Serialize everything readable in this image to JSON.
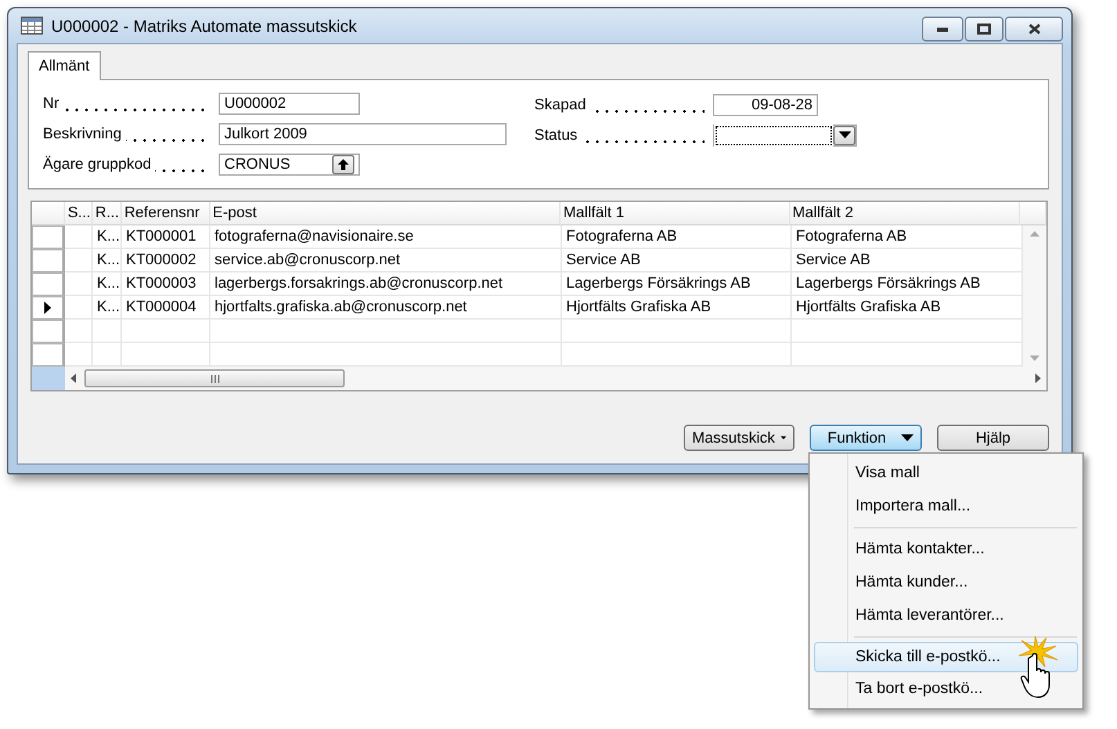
{
  "window": {
    "title": "U000002 - Matriks Automate massutskick"
  },
  "tabs": [
    {
      "label": "Allmänt",
      "selected": true
    }
  ],
  "fields_left": [
    {
      "label": "Nr",
      "value": "U000002",
      "kind": "text"
    },
    {
      "label": "Beskrivning",
      "value": "Julkort 2009",
      "kind": "wide"
    },
    {
      "label": "Ägare gruppkod",
      "value": "CRONUS",
      "kind": "lookup"
    }
  ],
  "fields_right": [
    {
      "label": "Skapad",
      "value": "09-08-28",
      "kind": "date"
    },
    {
      "label": "Status",
      "kind": "dropdown",
      "focused": true
    }
  ],
  "table": {
    "columns": [
      "S...",
      "R...",
      "Referensnr",
      "E-post",
      "Mallfält 1",
      "Mallfält 2"
    ],
    "rows": [
      {
        "cells": [
          "",
          "K...",
          "KT000001",
          "fotograferna@navisionaire.se",
          "Fotograferna AB",
          "Fotograferna AB"
        ],
        "selected": false
      },
      {
        "cells": [
          "",
          "K...",
          "KT000002",
          "service.ab@cronuscorp.net",
          "Service AB",
          "Service AB"
        ],
        "selected": false
      },
      {
        "cells": [
          "",
          "K...",
          "KT000003",
          "lagerbergs.forsakrings.ab@cronuscorp.net",
          "Lagerbergs Försäkrings AB",
          "Lagerbergs Försäkrings AB"
        ],
        "selected": false
      },
      {
        "cells": [
          "",
          "K...",
          "KT000004",
          "hjortfalts.grafiska.ab@cronuscorp.net",
          "Hjortfälts Grafiska AB",
          "Hjortfälts Grafiska AB"
        ],
        "selected": true
      }
    ]
  },
  "buttons": [
    {
      "label": "Massutskick",
      "kind": "dropdown",
      "pressed": false
    },
    {
      "label": "Funktion",
      "kind": "dropdown",
      "pressed": true
    },
    {
      "label": "Hjälp",
      "kind": "plain",
      "pressed": false
    }
  ],
  "menu": {
    "groups": [
      [
        {
          "label": "Visa mall",
          "selected": false
        },
        {
          "label": "Importera mall...",
          "selected": false
        }
      ],
      [
        {
          "label": "Hämta kontakter...",
          "selected": false
        },
        {
          "label": "Hämta kunder...",
          "selected": false
        },
        {
          "label": "Hämta leverantörer...",
          "selected": false
        }
      ],
      [
        {
          "label": "Skicka till e-postkö...",
          "selected": true
        },
        {
          "label": "Ta bort e-postkö...",
          "selected": false
        }
      ]
    ]
  }
}
